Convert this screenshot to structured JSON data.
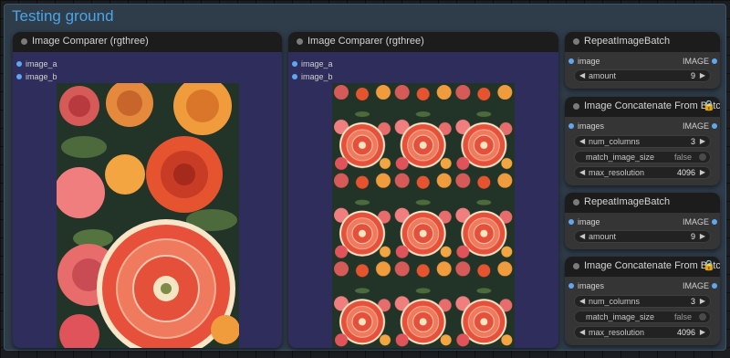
{
  "group": {
    "title": "Testing ground"
  },
  "comparers": [
    {
      "title": "Image Comparer (rgthree)",
      "inputs": [
        "image_a",
        "image_b"
      ]
    },
    {
      "title": "Image Comparer (rgthree)",
      "inputs": [
        "image_a",
        "image_b"
      ]
    }
  ],
  "repeat_nodes": [
    {
      "title": "RepeatImageBatch",
      "input": "image",
      "output": "IMAGE",
      "widget_label": "amount",
      "widget_value": "9"
    },
    {
      "title": "RepeatImageBatch",
      "input": "image",
      "output": "IMAGE",
      "widget_label": "amount",
      "widget_value": "9"
    }
  ],
  "concat_nodes": [
    {
      "title": "Image Concatenate From Batch",
      "badge": "🔒",
      "input": "images",
      "output": "IMAGE",
      "num_columns_label": "num_columns",
      "num_columns_value": "3",
      "match_label": "match_image_size",
      "match_value": "false",
      "max_label": "max_resolution",
      "max_value": "4096"
    },
    {
      "title": "Image Concatenate From Batch",
      "badge": "🔒",
      "input": "images",
      "output": "IMAGE",
      "num_columns_label": "num_columns",
      "num_columns_value": "3",
      "match_label": "match_image_size",
      "match_value": "false",
      "max_label": "max_resolution",
      "max_value": "4096"
    }
  ],
  "colors": {
    "canvas": "#1c1d20",
    "group_bg": "#2f3c49",
    "group_title": "#4aa4e6",
    "comparer_body": "#2e2d5b",
    "node_body": "#353535",
    "slot": "#5fa8ef",
    "badge": "#e8a53a"
  }
}
